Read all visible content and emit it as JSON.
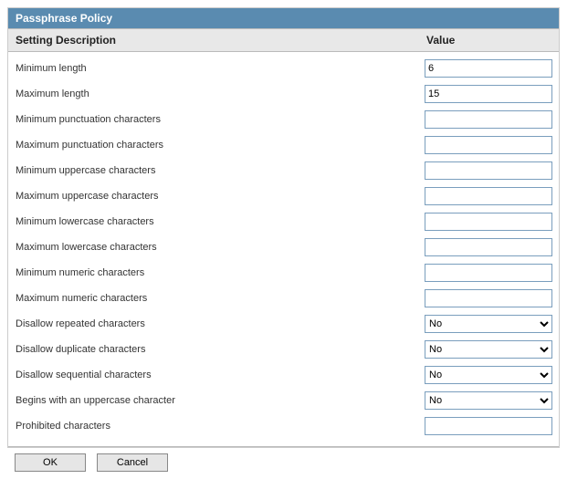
{
  "panel": {
    "title": "Passphrase Policy"
  },
  "columns": {
    "description": "Setting Description",
    "value": "Value"
  },
  "rows": [
    {
      "label": "Minimum length",
      "type": "text",
      "value": "6"
    },
    {
      "label": "Maximum length",
      "type": "text",
      "value": "15"
    },
    {
      "label": "Minimum punctuation characters",
      "type": "text",
      "value": ""
    },
    {
      "label": "Maximum punctuation characters",
      "type": "text",
      "value": ""
    },
    {
      "label": "Minimum uppercase characters",
      "type": "text",
      "value": ""
    },
    {
      "label": "Maximum uppercase characters",
      "type": "text",
      "value": ""
    },
    {
      "label": "Minimum lowercase characters",
      "type": "text",
      "value": ""
    },
    {
      "label": "Maximum lowercase characters",
      "type": "text",
      "value": ""
    },
    {
      "label": "Minimum numeric characters",
      "type": "text",
      "value": ""
    },
    {
      "label": "Maximum numeric characters",
      "type": "text",
      "value": ""
    },
    {
      "label": "Disallow repeated characters",
      "type": "select",
      "value": "No"
    },
    {
      "label": "Disallow duplicate characters",
      "type": "select",
      "value": "No"
    },
    {
      "label": "Disallow sequential characters",
      "type": "select",
      "value": "No"
    },
    {
      "label": "Begins with an uppercase character",
      "type": "select",
      "value": "No"
    },
    {
      "label": "Prohibited characters",
      "type": "text",
      "value": ""
    }
  ],
  "buttons": {
    "ok": "OK",
    "cancel": "Cancel"
  }
}
